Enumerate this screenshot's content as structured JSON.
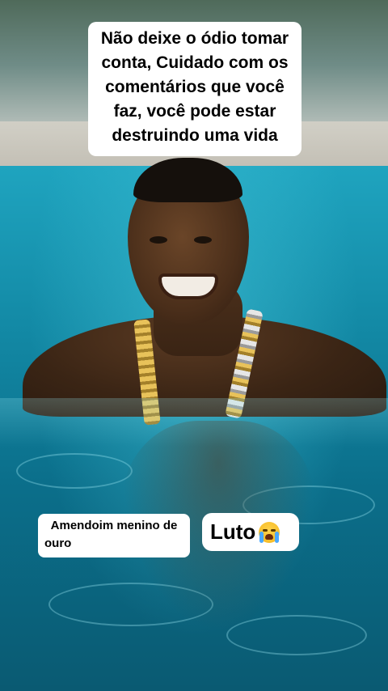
{
  "story": {
    "caption_lines": [
      "Não deixe o ódio tomar",
      "conta, Cuidado com os",
      "comentários que você",
      "faz, você pode estar",
      "destruindo uma vida"
    ],
    "tag_lines": [
      "Amendoim menino de",
      "ouro"
    ],
    "reaction_text": "Luto",
    "reaction_icon": "loudly-crying-face-icon"
  },
  "colors": {
    "bubble_background": "#ffffff",
    "text": "#000000",
    "water": "#138aa6"
  }
}
